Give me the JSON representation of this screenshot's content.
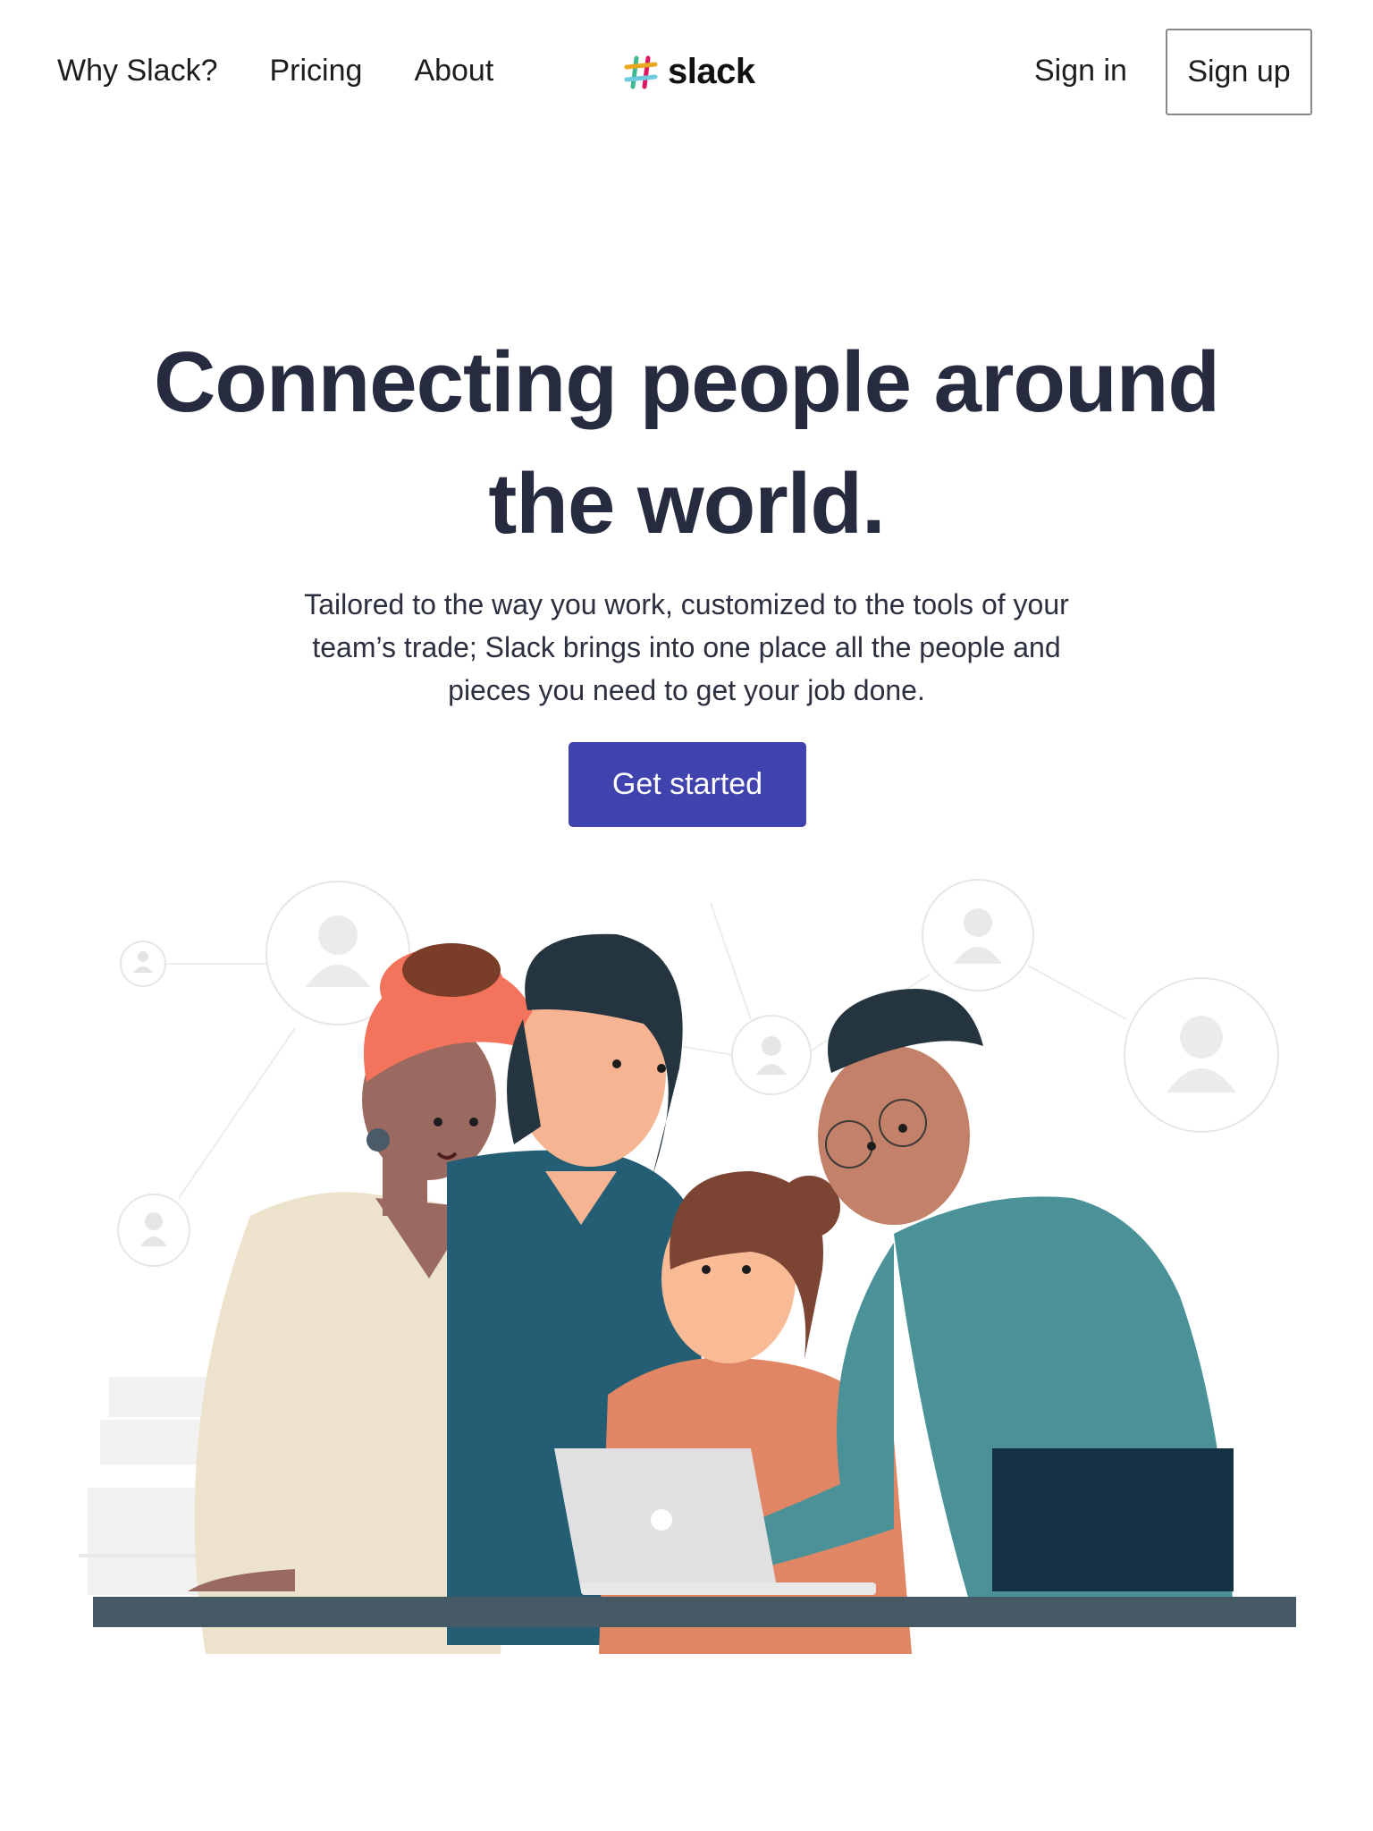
{
  "nav": {
    "links": [
      {
        "label": "Why Slack?"
      },
      {
        "label": "Pricing"
      },
      {
        "label": "About"
      }
    ],
    "logo_text": "slack",
    "sign_in": "Sign in",
    "sign_up": "Sign up"
  },
  "hero": {
    "title_line1": "Connecting people around",
    "title_line2": "the world.",
    "subtitle_line1": "Tailored to the way you work, customized to the tools of your",
    "subtitle_line2": "team’s trade; Slack brings into one place all the people and",
    "subtitle_line3": "pieces you need to get your job done.",
    "cta_label": "Get started"
  },
  "illustration": {
    "subject": "four-people-around-laptop",
    "colors": {
      "cta": "#4042ad",
      "headline": "#262b40",
      "desk": "#455a64",
      "sweater_teal": "#4a9298",
      "shirt_blue": "#245e74",
      "shirt_orange": "#e08664",
      "dress_cream": "#ede3cc",
      "turban": "#f4735c"
    }
  }
}
